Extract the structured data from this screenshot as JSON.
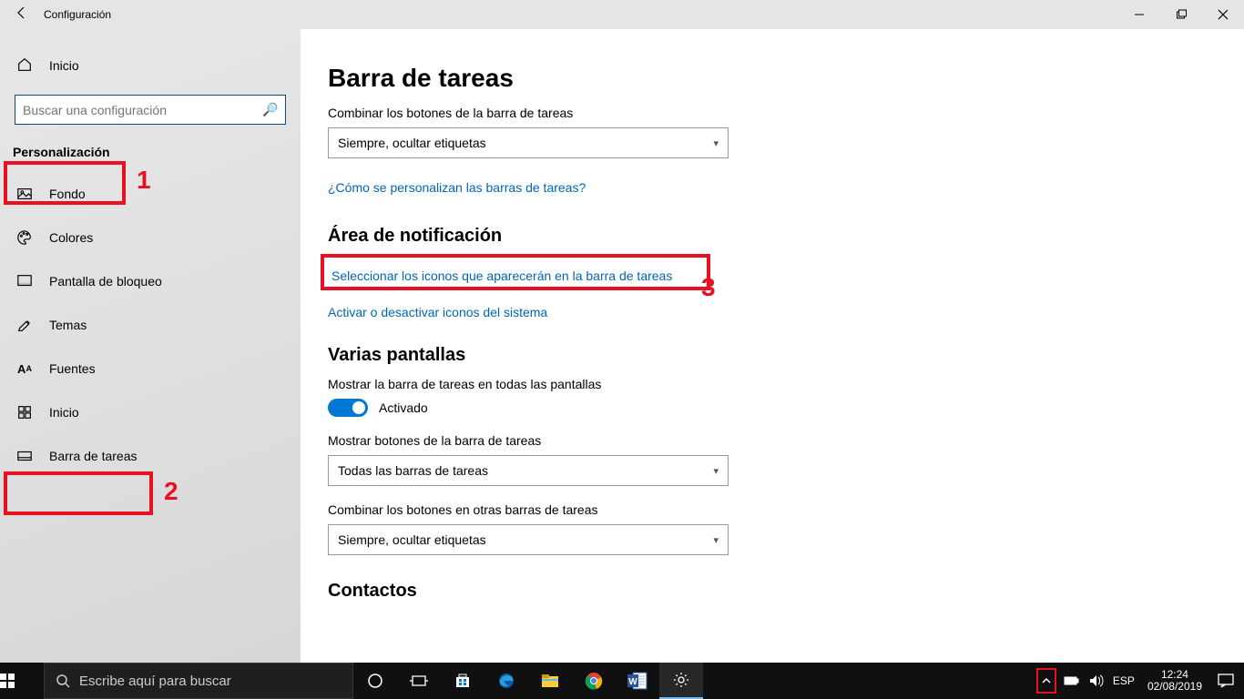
{
  "titlebar": {
    "title": "Configuración"
  },
  "sidebar": {
    "home": "Inicio",
    "search_placeholder": "Buscar una configuración",
    "category": "Personalización",
    "items": [
      {
        "label": "Fondo"
      },
      {
        "label": "Colores"
      },
      {
        "label": "Pantalla de bloqueo"
      },
      {
        "label": "Temas"
      },
      {
        "label": "Fuentes"
      },
      {
        "label": "Inicio"
      },
      {
        "label": "Barra de tareas"
      }
    ]
  },
  "annotations": {
    "n1": "1",
    "n2": "2",
    "n3": "3"
  },
  "main": {
    "heading": "Barra de tareas",
    "combine_label": "Combinar los botones de la barra de tareas",
    "combine_value": "Siempre, ocultar etiquetas",
    "help_link": "¿Cómo se personalizan las barras de tareas?",
    "notif_heading": "Área de notificación",
    "notif_link1": "Seleccionar los iconos que aparecerán en la barra de tareas",
    "notif_link2": "Activar o desactivar iconos del sistema",
    "multi_heading": "Varias pantallas",
    "multi_show_label": "Mostrar la barra de tareas en todas las pantallas",
    "toggle_state": "Activado",
    "show_buttons_label": "Mostrar botones de la barra de tareas",
    "show_buttons_value": "Todas las barras de tareas",
    "combine_other_label": "Combinar los botones en otras barras de tareas",
    "combine_other_value": "Siempre, ocultar etiquetas",
    "contacts_heading": "Contactos"
  },
  "taskbar": {
    "search_placeholder": "Escribe aquí para buscar",
    "lang": "ESP",
    "time": "12:24",
    "date": "02/08/2019"
  }
}
